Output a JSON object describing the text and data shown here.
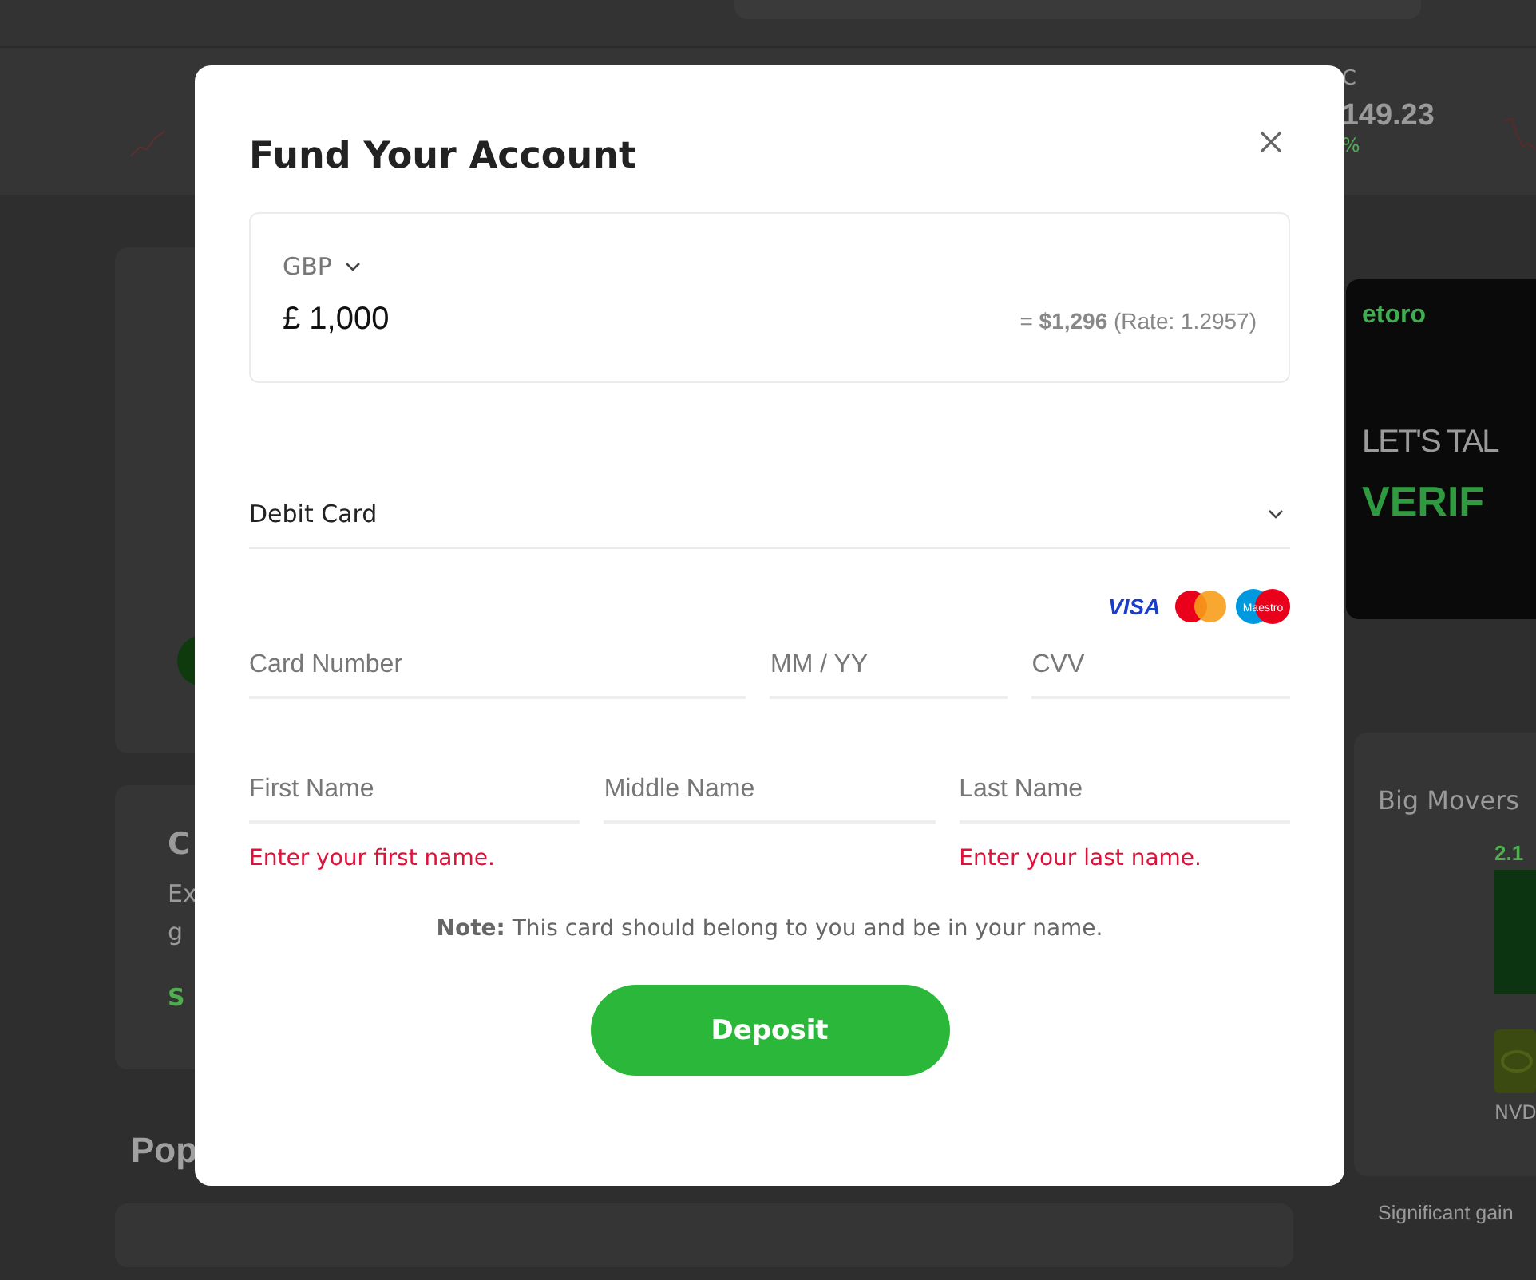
{
  "backdrop": {
    "ticker": {
      "symbol": "C",
      "price": "149.23",
      "change": "%"
    },
    "left_cards": [
      {
        "heading": "C",
        "lines": [
          "Ex",
          "g"
        ],
        "link": "S"
      }
    ],
    "section_heading": "Pop",
    "banner": {
      "brand": "etoro",
      "line_1": "LET'S TAL",
      "line_2": "VERIF"
    },
    "big_movers": {
      "title": "Big Movers",
      "change": "2.1",
      "symbol": "NVD"
    },
    "footnote": "Significant gain"
  },
  "modal": {
    "title": "Fund Your Account",
    "currency": "GBP",
    "amount": "£ 1,000",
    "conversion": "= **$1,296** (Rate: 1.2957)",
    "payment_method": "Debit Card",
    "card_logos": [
      {
        "kind": "visa",
        "label": "VISA"
      },
      {
        "kind": "mastercard"
      },
      {
        "kind": "maestro",
        "label": "Maestro"
      }
    ],
    "field_rows": [
      [
        {
          "placeholder": "Card Number"
        },
        {
          "placeholder": "MM / YY"
        },
        {
          "placeholder": "CVV"
        }
      ],
      [
        {
          "placeholder": "First Name",
          "error": "Enter your first name."
        },
        {
          "placeholder": "Middle Name"
        },
        {
          "placeholder": "Last Name",
          "error": "Enter your last name."
        }
      ]
    ],
    "note": "**Note:** This card should belong to you and be in your name.",
    "button": "Deposit"
  }
}
